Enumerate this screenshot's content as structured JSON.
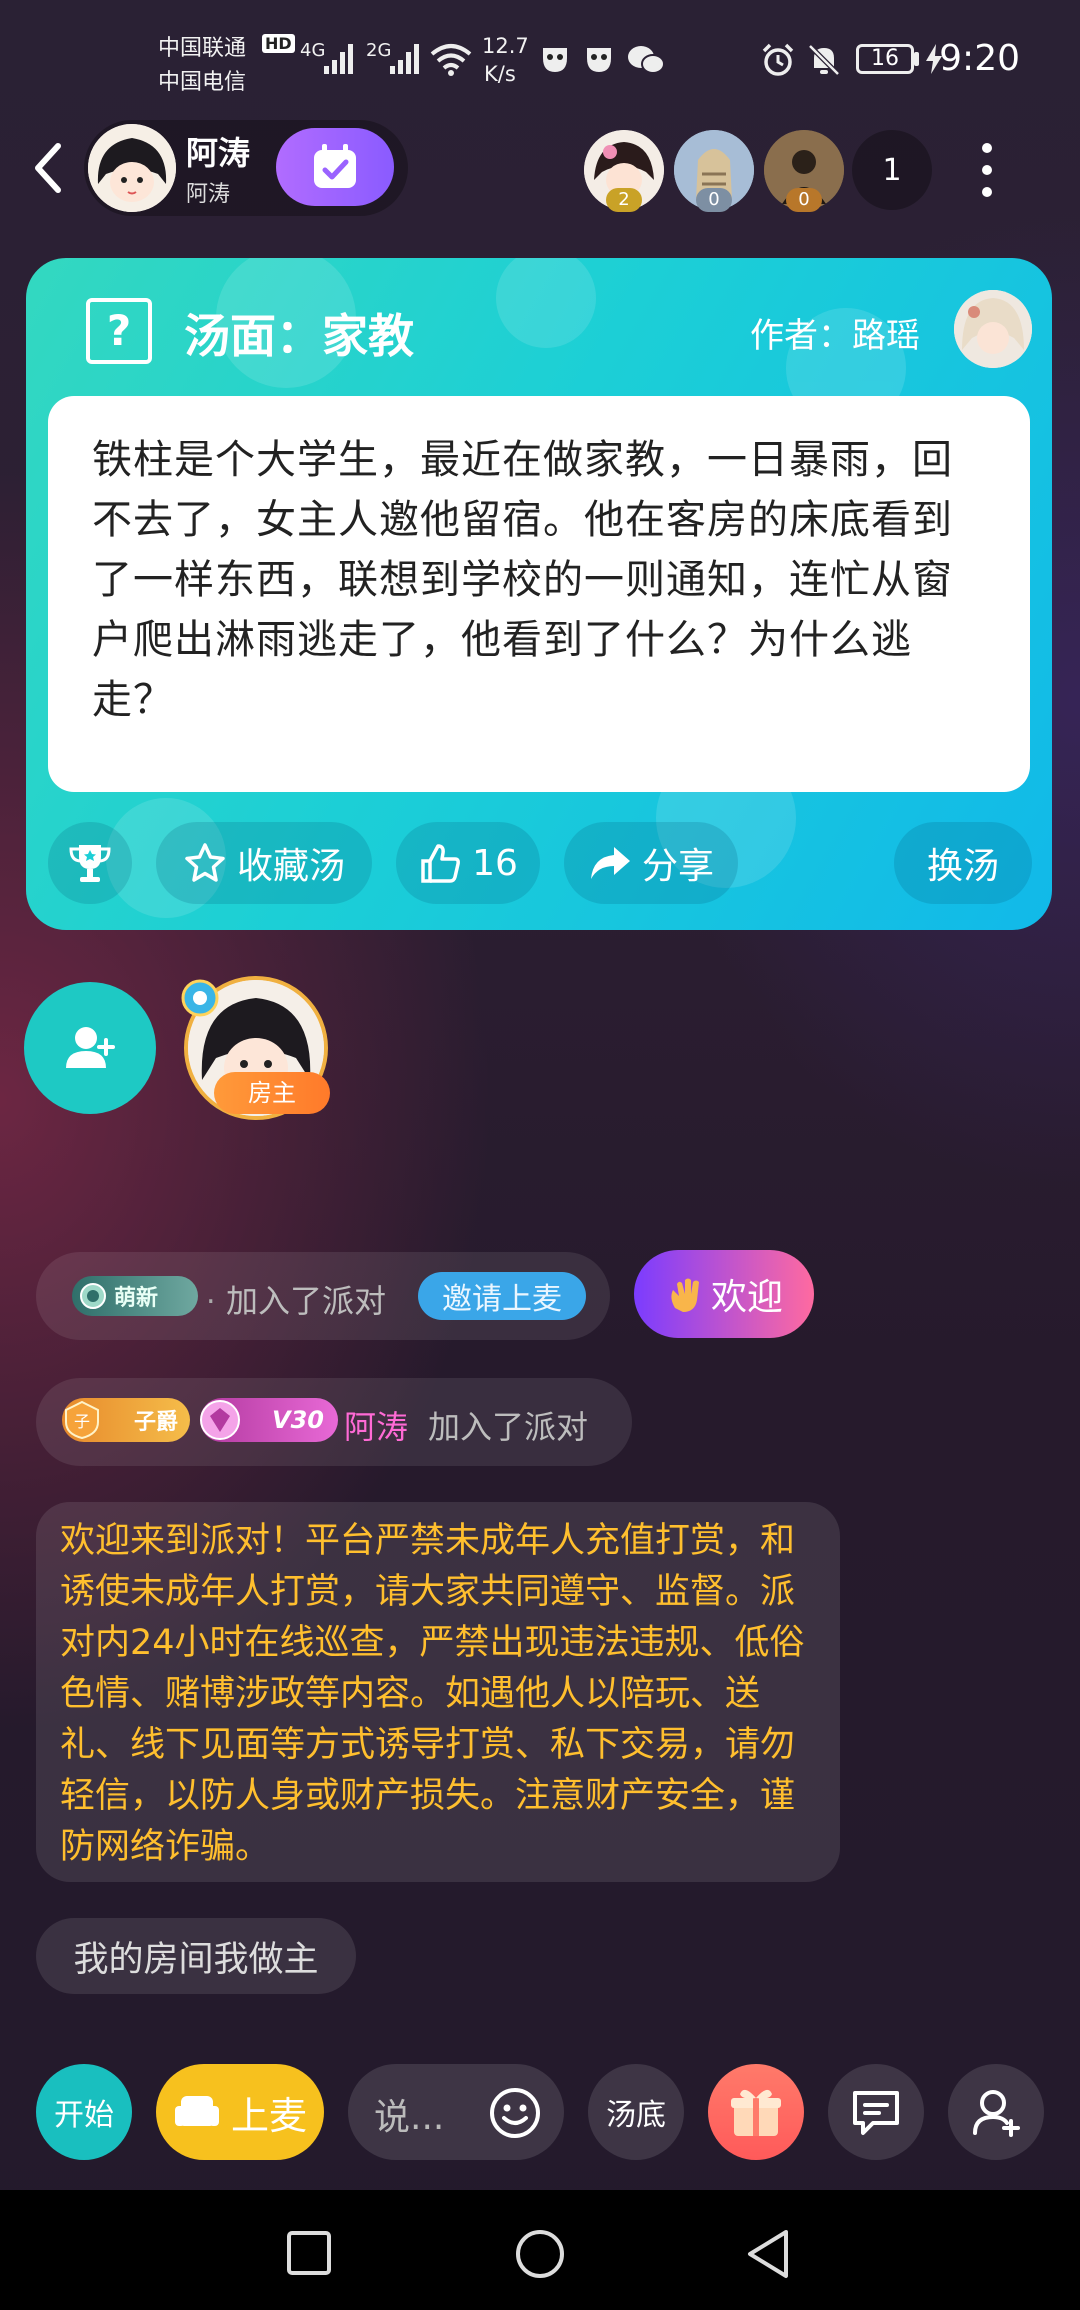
{
  "status_bar": {
    "carrier1": "中国联通",
    "carrier1_tag": "HD",
    "carrier2": "中国电信",
    "net1": "4G",
    "net2": "2G",
    "speed": "12.7",
    "speed_unit": "K/s",
    "battery": "16",
    "time": "9:20"
  },
  "header": {
    "host_name": "阿涛",
    "host_sub": "阿涛",
    "audience": [
      {
        "badge": "2",
        "badge_color": "#c9a227"
      },
      {
        "badge": "0",
        "badge_color": "#7d8fa3"
      },
      {
        "badge": "0",
        "badge_color": "#b8772a"
      }
    ],
    "online_count": "1"
  },
  "card": {
    "title": "汤面：家教",
    "author": "作者：路瑶",
    "text": "铁柱是个大学生，最近在做家教，一日暴雨，回不去了，女主人邀他留宿。他在客房的床底看到了一样东西，联想到学校的一则通知，连忙从窗户爬出淋雨逃走了，他看到了什么？为什么逃走？",
    "collect_label": "收藏汤",
    "like_count": "16",
    "share_label": "分享",
    "switch_label": "换汤"
  },
  "seats": {
    "host_tag": "房主"
  },
  "chat": {
    "msg1": {
      "tag": "萌新",
      "dot": ".",
      "text": "加入了派对",
      "action": "邀请上麦"
    },
    "welcome_label": "欢迎",
    "msg2": {
      "tag1": "子爵",
      "tag2": "V30",
      "user": "阿涛",
      "text": "加入了派对"
    },
    "notice": "欢迎来到派对！平台严禁未成年人充值打赏，和诱使未成年人打赏，请大家共同遵守、监督。派对内24小时在线巡查，严禁出现违法违规、低俗色情、赌博涉政等内容。如遇他人以陪玩、送礼、线下见面等方式诱导打赏、私下交易，请勿轻信，以防人身或财产损失。注意财产安全，谨防网络诈骗。",
    "msg3": "我的房间我做主"
  },
  "toolbar": {
    "start_label": "开始",
    "mic_label": "上麦",
    "say_placeholder": "说...",
    "answer_label": "汤底"
  },
  "colors": {
    "accent_teal": "#1ec9c4",
    "notice_text": "#ffbf2e",
    "mic_yellow": "#f7c11e",
    "username_pink": "#ff6ad5"
  }
}
